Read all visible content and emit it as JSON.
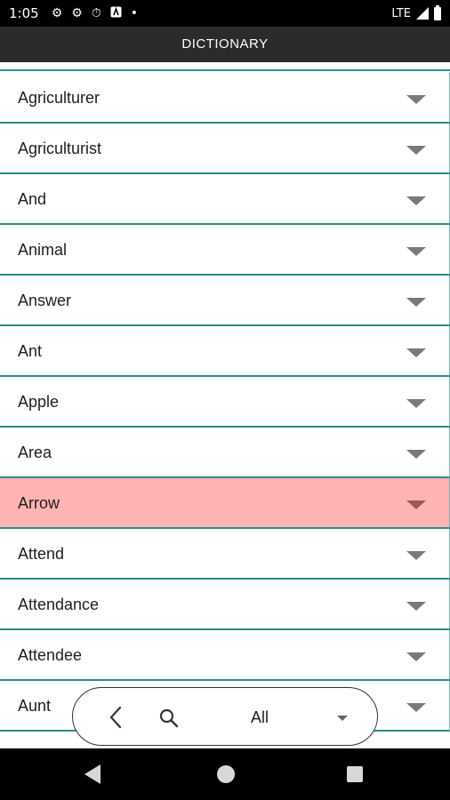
{
  "status_bar": {
    "time": "1:05",
    "network": "LTE",
    "icons": [
      "gear-icon",
      "gear-icon",
      "timer-icon",
      "app-notification-icon",
      "dot-icon",
      "signal-icon",
      "battery-icon"
    ]
  },
  "app_bar": {
    "title": "DICTIONARY"
  },
  "word_list": {
    "items": [
      {
        "label": "Agriculturer"
      },
      {
        "label": "Agriculturist"
      },
      {
        "label": "And"
      },
      {
        "label": "Animal"
      },
      {
        "label": "Answer"
      },
      {
        "label": "Ant"
      },
      {
        "label": "Apple"
      },
      {
        "label": "Area"
      },
      {
        "label": "Arrow",
        "selected": true
      },
      {
        "label": "Attend"
      },
      {
        "label": "Attendance"
      },
      {
        "label": "Attendee"
      },
      {
        "label": "Aunt"
      }
    ],
    "selected_color": "#ffb3b3",
    "divider_color": "#2e8b8b"
  },
  "filter_bar": {
    "back_icon": "chevron-left-icon",
    "search_icon": "search-icon",
    "selected_filter": "All",
    "dropdown_icon": "caret-down-icon"
  },
  "nav_bar": {
    "icons": [
      "back-triangle-icon",
      "home-circle-icon",
      "recents-square-icon"
    ]
  }
}
